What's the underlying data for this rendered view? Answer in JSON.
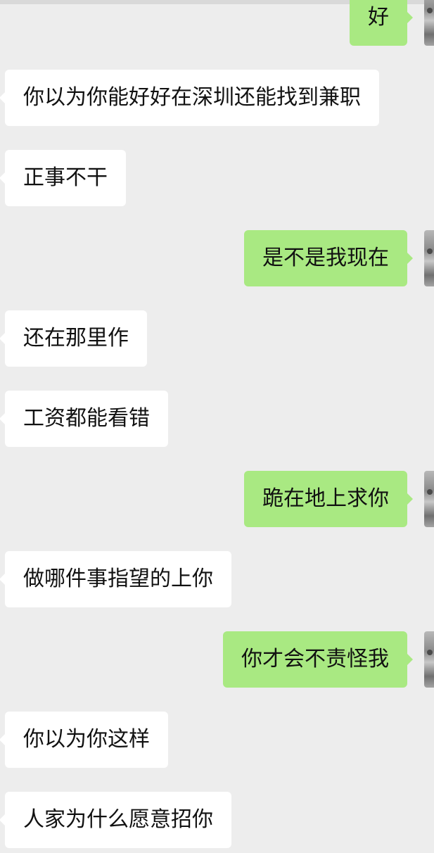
{
  "chat": {
    "messages": [
      {
        "sender": "me",
        "text": "好"
      },
      {
        "sender": "other",
        "text": "你以为你能好好在深圳还能找到兼职"
      },
      {
        "sender": "other",
        "text": "正事不干"
      },
      {
        "sender": "me",
        "text": "是不是我现在"
      },
      {
        "sender": "other",
        "text": "还在那里作"
      },
      {
        "sender": "other",
        "text": "工资都能看错"
      },
      {
        "sender": "me",
        "text": "跪在地上求你"
      },
      {
        "sender": "other",
        "text": "做哪件事指望的上你"
      },
      {
        "sender": "me",
        "text": "你才会不责怪我"
      },
      {
        "sender": "other",
        "text": "你以为你这样"
      },
      {
        "sender": "other",
        "text": "人家为什么愿意招你"
      }
    ]
  },
  "colors": {
    "background": "#ededed",
    "my_bubble": "#a9e982",
    "other_bubble": "#ffffff",
    "text": "#111111"
  },
  "icons": {
    "my_avatar": "cat-avatar-icon"
  }
}
